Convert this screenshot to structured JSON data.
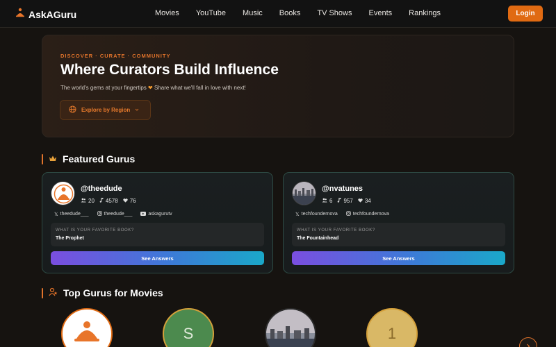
{
  "app": {
    "name": "AskAGuru"
  },
  "nav": {
    "links": [
      "Movies",
      "YouTube",
      "Music",
      "Books",
      "TV Shows",
      "Events",
      "Rankings"
    ],
    "login_label": "Login"
  },
  "hero": {
    "eyebrow": "DISCOVER · CURATE · COMMUNITY",
    "title": "Where Curators Build Influence",
    "subtitle_before": "The world's gems at your fingertips ",
    "subtitle_after": " Share what we'll fall in love with next!",
    "explore_label": "Explore by Region"
  },
  "featured": {
    "title": "Featured Gurus",
    "cards": [
      {
        "handle": "@theedude",
        "followers": "20",
        "items": "4578",
        "likes": "76",
        "socials": [
          "theedude___",
          "theedude___",
          "askagurutv"
        ],
        "question": "WHAT IS YOUR FAVORITE BOOK?",
        "answer": "The Prophet",
        "button": "See Answers"
      },
      {
        "handle": "@nvatunes",
        "followers": "6",
        "items": "957",
        "likes": "34",
        "socials": [
          "techfoundernova",
          "techfoundernova"
        ],
        "question": "WHAT IS YOUR FAVORITE BOOK?",
        "answer": "The Fountainhead",
        "button": "See Answers"
      }
    ]
  },
  "top": {
    "title": "Top Gurus for Movies",
    "avatars": [
      {
        "letter": ""
      },
      {
        "letter": "S"
      },
      {
        "letter": ""
      },
      {
        "letter": "1"
      }
    ]
  },
  "colors": {
    "accent": "#e0732b",
    "login_bg": "#e06a12",
    "card_border": "#2d4a43"
  }
}
